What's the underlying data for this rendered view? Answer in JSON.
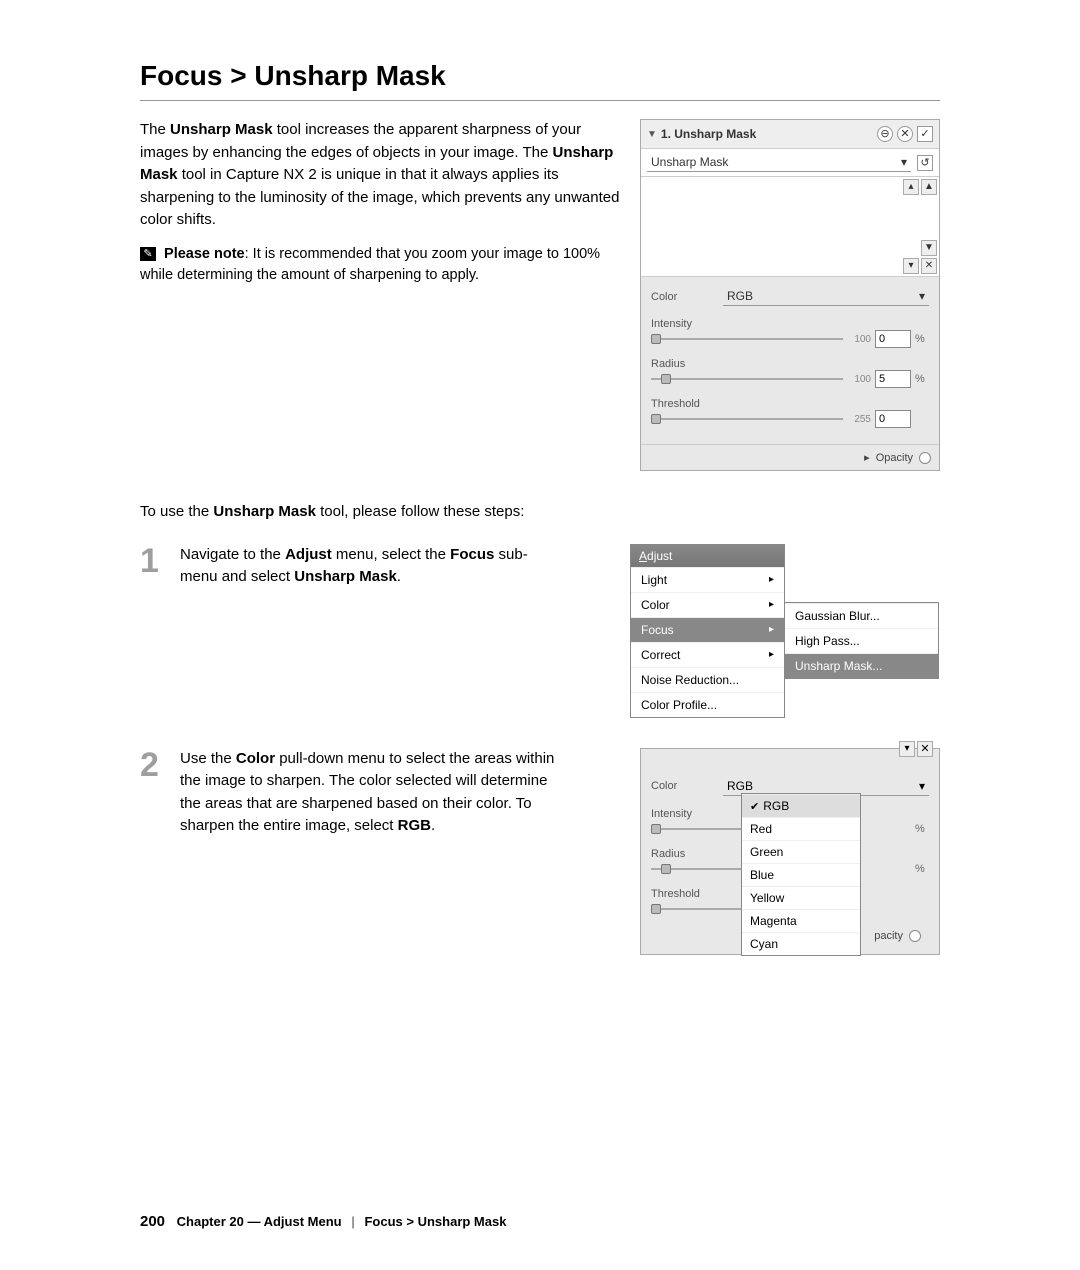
{
  "title": "Focus > Unsharp Mask",
  "intro": {
    "p1a": "The ",
    "p1b": "Unsharp Mask",
    "p1c": " tool increases the apparent sharpness of your images by enhancing the edges of objects in your image. The ",
    "p1d": "Unsharp Mask",
    "p1e": " tool in Capture NX 2 is unique in that it always applies its sharpening to the luminosity of the image, which prevents any unwanted color shifts."
  },
  "note": {
    "label": "Please note",
    "text": ": It is recommended that you zoom your image to 100% while determining the amount of sharpening to apply."
  },
  "panel1": {
    "title": "1. Unsharp Mask",
    "selector_label": "Unsharp Mask",
    "color_label": "Color",
    "color_value": "RGB",
    "intensity_label": "Intensity",
    "intensity_max": "100",
    "intensity_value": "0",
    "radius_label": "Radius",
    "radius_max": "100",
    "radius_value": "5",
    "threshold_label": "Threshold",
    "threshold_max": "255",
    "threshold_value": "0",
    "percent": "%",
    "opacity_label": "Opacity"
  },
  "stepsintro": {
    "a": "To use the ",
    "b": "Unsharp Mask",
    "c": " tool, please follow these steps:"
  },
  "step1": {
    "num": "1",
    "a": "Navigate to the ",
    "b": "Adjust",
    "c": " menu, select the ",
    "d": "Focus",
    "e": " sub-menu and select ",
    "f": "Unsharp Mask",
    "g": "."
  },
  "menu": {
    "title": "Adjust",
    "items": [
      "Light",
      "Color",
      "Focus",
      "Correct",
      "Noise Reduction...",
      "Color Profile..."
    ],
    "sub": [
      "Gaussian Blur...",
      "High Pass...",
      "Unsharp Mask..."
    ]
  },
  "step2": {
    "num": "2",
    "a": "Use the ",
    "b": "Color",
    "c": " pull-down menu to select the areas within the image to sharpen. The color selected will determine the areas that are sharpened based on their color. To sharpen the entire image, select ",
    "d": "RGB",
    "e": "."
  },
  "panel2": {
    "color_label": "Color",
    "color_value": "RGB",
    "intensity_label": "Intensity",
    "radius_label": "Radius",
    "threshold_label": "Threshold",
    "percent": "%",
    "opacity_label": "pacity",
    "options": [
      "RGB",
      "Red",
      "Green",
      "Blue",
      "Yellow",
      "Magenta",
      "Cyan"
    ]
  },
  "footer": {
    "page": "200",
    "chapter": "Chapter 20 — Adjust Menu",
    "crumb": "Focus > Unsharp Mask"
  }
}
